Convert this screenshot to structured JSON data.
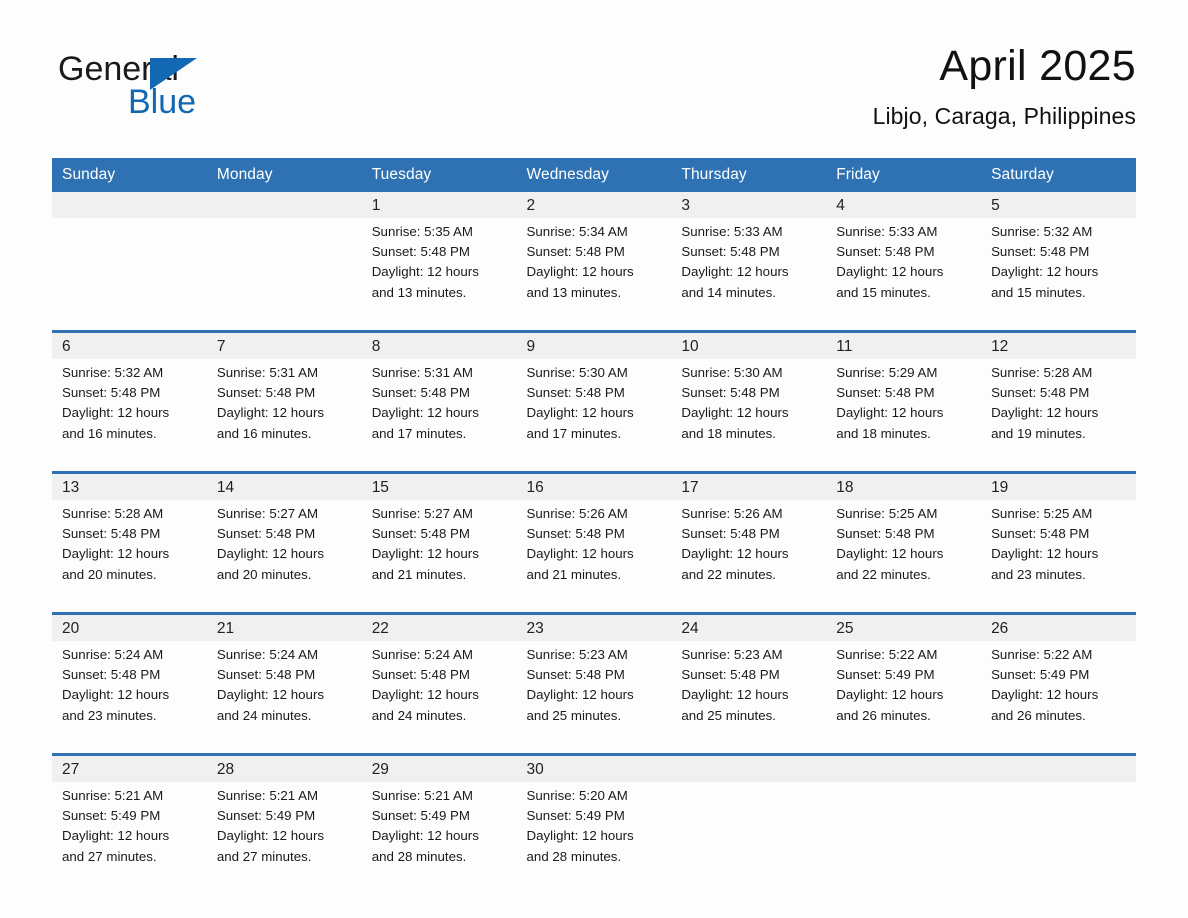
{
  "brand": {
    "name_part1": "General",
    "name_part2": "Blue",
    "triangle_color": "#1268b3",
    "blue_color": "#1268b3"
  },
  "header": {
    "title": "April 2025",
    "subtitle": "Libjo, Caraga, Philippines",
    "accent_color": "#2f72b4",
    "daynum_bg": "#f0f0f0"
  },
  "weekday_headers": [
    "Sunday",
    "Monday",
    "Tuesday",
    "Wednesday",
    "Thursday",
    "Friday",
    "Saturday"
  ],
  "weeks": [
    {
      "days": [
        {
          "num": "",
          "lines": []
        },
        {
          "num": "",
          "lines": []
        },
        {
          "num": "1",
          "lines": [
            "Sunrise: 5:35 AM",
            "Sunset: 5:48 PM",
            "Daylight: 12 hours",
            "and 13 minutes."
          ]
        },
        {
          "num": "2",
          "lines": [
            "Sunrise: 5:34 AM",
            "Sunset: 5:48 PM",
            "Daylight: 12 hours",
            "and 13 minutes."
          ]
        },
        {
          "num": "3",
          "lines": [
            "Sunrise: 5:33 AM",
            "Sunset: 5:48 PM",
            "Daylight: 12 hours",
            "and 14 minutes."
          ]
        },
        {
          "num": "4",
          "lines": [
            "Sunrise: 5:33 AM",
            "Sunset: 5:48 PM",
            "Daylight: 12 hours",
            "and 15 minutes."
          ]
        },
        {
          "num": "5",
          "lines": [
            "Sunrise: 5:32 AM",
            "Sunset: 5:48 PM",
            "Daylight: 12 hours",
            "and 15 minutes."
          ]
        }
      ]
    },
    {
      "days": [
        {
          "num": "6",
          "lines": [
            "Sunrise: 5:32 AM",
            "Sunset: 5:48 PM",
            "Daylight: 12 hours",
            "and 16 minutes."
          ]
        },
        {
          "num": "7",
          "lines": [
            "Sunrise: 5:31 AM",
            "Sunset: 5:48 PM",
            "Daylight: 12 hours",
            "and 16 minutes."
          ]
        },
        {
          "num": "8",
          "lines": [
            "Sunrise: 5:31 AM",
            "Sunset: 5:48 PM",
            "Daylight: 12 hours",
            "and 17 minutes."
          ]
        },
        {
          "num": "9",
          "lines": [
            "Sunrise: 5:30 AM",
            "Sunset: 5:48 PM",
            "Daylight: 12 hours",
            "and 17 minutes."
          ]
        },
        {
          "num": "10",
          "lines": [
            "Sunrise: 5:30 AM",
            "Sunset: 5:48 PM",
            "Daylight: 12 hours",
            "and 18 minutes."
          ]
        },
        {
          "num": "11",
          "lines": [
            "Sunrise: 5:29 AM",
            "Sunset: 5:48 PM",
            "Daylight: 12 hours",
            "and 18 minutes."
          ]
        },
        {
          "num": "12",
          "lines": [
            "Sunrise: 5:28 AM",
            "Sunset: 5:48 PM",
            "Daylight: 12 hours",
            "and 19 minutes."
          ]
        }
      ]
    },
    {
      "days": [
        {
          "num": "13",
          "lines": [
            "Sunrise: 5:28 AM",
            "Sunset: 5:48 PM",
            "Daylight: 12 hours",
            "and 20 minutes."
          ]
        },
        {
          "num": "14",
          "lines": [
            "Sunrise: 5:27 AM",
            "Sunset: 5:48 PM",
            "Daylight: 12 hours",
            "and 20 minutes."
          ]
        },
        {
          "num": "15",
          "lines": [
            "Sunrise: 5:27 AM",
            "Sunset: 5:48 PM",
            "Daylight: 12 hours",
            "and 21 minutes."
          ]
        },
        {
          "num": "16",
          "lines": [
            "Sunrise: 5:26 AM",
            "Sunset: 5:48 PM",
            "Daylight: 12 hours",
            "and 21 minutes."
          ]
        },
        {
          "num": "17",
          "lines": [
            "Sunrise: 5:26 AM",
            "Sunset: 5:48 PM",
            "Daylight: 12 hours",
            "and 22 minutes."
          ]
        },
        {
          "num": "18",
          "lines": [
            "Sunrise: 5:25 AM",
            "Sunset: 5:48 PM",
            "Daylight: 12 hours",
            "and 22 minutes."
          ]
        },
        {
          "num": "19",
          "lines": [
            "Sunrise: 5:25 AM",
            "Sunset: 5:48 PM",
            "Daylight: 12 hours",
            "and 23 minutes."
          ]
        }
      ]
    },
    {
      "days": [
        {
          "num": "20",
          "lines": [
            "Sunrise: 5:24 AM",
            "Sunset: 5:48 PM",
            "Daylight: 12 hours",
            "and 23 minutes."
          ]
        },
        {
          "num": "21",
          "lines": [
            "Sunrise: 5:24 AM",
            "Sunset: 5:48 PM",
            "Daylight: 12 hours",
            "and 24 minutes."
          ]
        },
        {
          "num": "22",
          "lines": [
            "Sunrise: 5:24 AM",
            "Sunset: 5:48 PM",
            "Daylight: 12 hours",
            "and 24 minutes."
          ]
        },
        {
          "num": "23",
          "lines": [
            "Sunrise: 5:23 AM",
            "Sunset: 5:48 PM",
            "Daylight: 12 hours",
            "and 25 minutes."
          ]
        },
        {
          "num": "24",
          "lines": [
            "Sunrise: 5:23 AM",
            "Sunset: 5:48 PM",
            "Daylight: 12 hours",
            "and 25 minutes."
          ]
        },
        {
          "num": "25",
          "lines": [
            "Sunrise: 5:22 AM",
            "Sunset: 5:49 PM",
            "Daylight: 12 hours",
            "and 26 minutes."
          ]
        },
        {
          "num": "26",
          "lines": [
            "Sunrise: 5:22 AM",
            "Sunset: 5:49 PM",
            "Daylight: 12 hours",
            "and 26 minutes."
          ]
        }
      ]
    },
    {
      "days": [
        {
          "num": "27",
          "lines": [
            "Sunrise: 5:21 AM",
            "Sunset: 5:49 PM",
            "Daylight: 12 hours",
            "and 27 minutes."
          ]
        },
        {
          "num": "28",
          "lines": [
            "Sunrise: 5:21 AM",
            "Sunset: 5:49 PM",
            "Daylight: 12 hours",
            "and 27 minutes."
          ]
        },
        {
          "num": "29",
          "lines": [
            "Sunrise: 5:21 AM",
            "Sunset: 5:49 PM",
            "Daylight: 12 hours",
            "and 28 minutes."
          ]
        },
        {
          "num": "30",
          "lines": [
            "Sunrise: 5:20 AM",
            "Sunset: 5:49 PM",
            "Daylight: 12 hours",
            "and 28 minutes."
          ]
        },
        {
          "num": "",
          "lines": []
        },
        {
          "num": "",
          "lines": []
        },
        {
          "num": "",
          "lines": []
        }
      ]
    }
  ]
}
